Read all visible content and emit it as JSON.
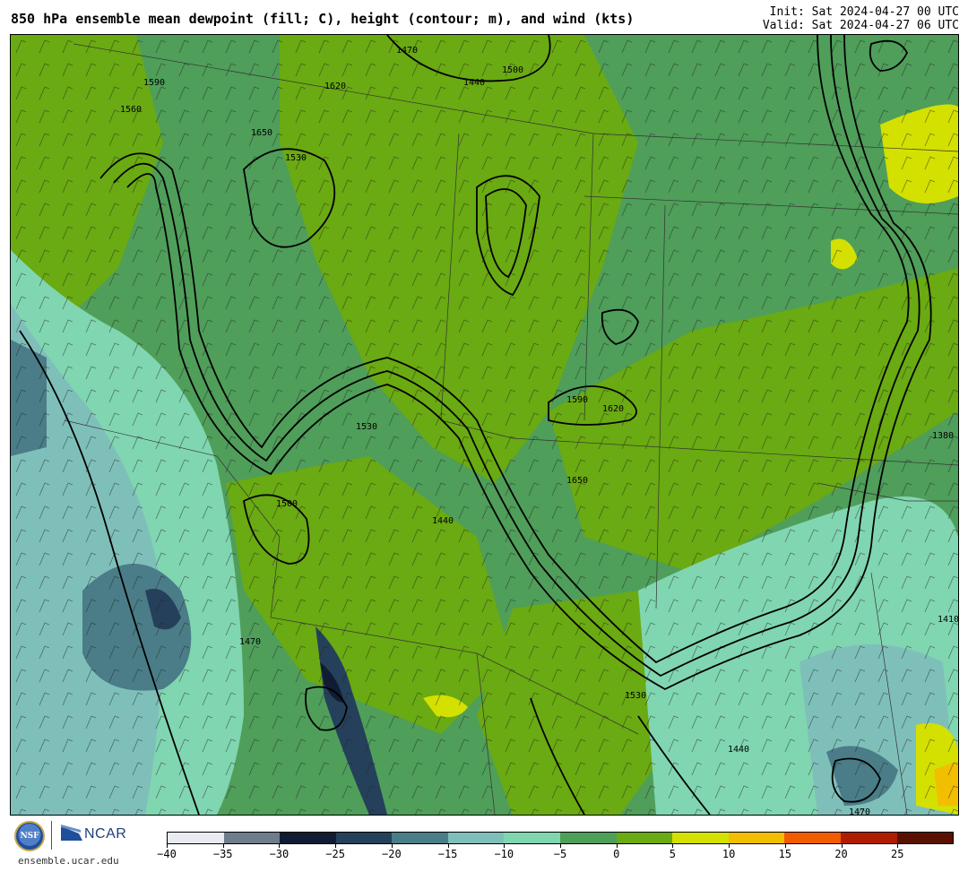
{
  "header": {
    "title": "850 hPa ensemble mean dewpoint (fill; C), height (contour; m), and wind (kts)",
    "init": "Init: Sat 2024-04-27 00 UTC",
    "valid": "Valid: Sat 2024-04-27 06 UTC"
  },
  "footer": {
    "site": "ensemble.ucar.edu",
    "nsf_label": "NSF",
    "ncar_label": "NCAR"
  },
  "colorbar": {
    "ticks": [
      "−40",
      "−35",
      "−30",
      "−25",
      "−20",
      "−15",
      "−10",
      "−5",
      "0",
      "5",
      "10",
      "15",
      "20",
      "25"
    ],
    "colors": [
      "#e8ecf0",
      "#6e7d8c",
      "#101c33",
      "#25405a",
      "#4a7d87",
      "#7fbfba",
      "#80d6b0",
      "#4f9e5a",
      "#6aaa12",
      "#d4e000",
      "#f2be00",
      "#f25c00",
      "#b01c00",
      "#5a1000"
    ]
  },
  "contour_labels": [
    "1590",
    "1560",
    "1530",
    "1620",
    "1470",
    "1500",
    "1440",
    "1650",
    "1410",
    "1380"
  ],
  "map_legend_colors": {
    "green_dark": "#4f9e5a",
    "green_light": "#6aaa12",
    "teal": "#80d6b0",
    "teal_dark": "#7fbfba",
    "slate": "#4a7d87",
    "navy": "#25405a",
    "yellow": "#d4e000",
    "orange": "#f2be00"
  }
}
